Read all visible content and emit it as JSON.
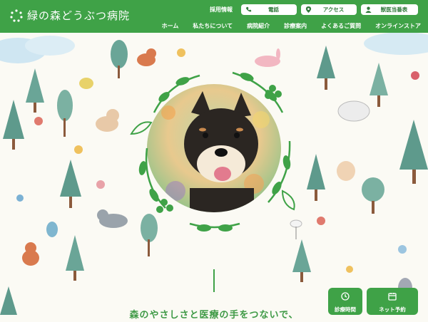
{
  "header": {
    "logo_text": "緑の森どうぶつ病院",
    "recruit": "採用情報",
    "phone_label": "電話",
    "access_label": "アクセス",
    "doctor_label": "獣医当番表"
  },
  "nav": {
    "items": [
      "ホーム",
      "私たちについて",
      "病院紹介",
      "診療案内",
      "よくあるご質問",
      "オンラインストア"
    ]
  },
  "hero": {
    "tagline": "森のやさしさと医療の手をつないで、"
  },
  "cta": {
    "hours_label": "診療時間",
    "reserve_label": "ネット予約"
  },
  "colors": {
    "brand": "#3fa247",
    "background": "#fbfaf4"
  },
  "icons": [
    "phone-icon",
    "location-pin-icon",
    "person-icon",
    "clock-icon",
    "calendar-icon"
  ]
}
